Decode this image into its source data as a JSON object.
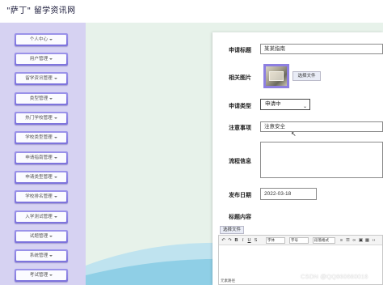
{
  "site": {
    "title": "\"萨丁\" 留学资讯网"
  },
  "sidebar": {
    "items": [
      {
        "label": "个人中心"
      },
      {
        "label": "用户管理"
      },
      {
        "label": "留学资讯管理"
      },
      {
        "label": "类型管理"
      },
      {
        "label": "热门学校管理"
      },
      {
        "label": "学校类型管理"
      },
      {
        "label": "申请指南管理"
      },
      {
        "label": "申请类型管理"
      },
      {
        "label": "学校排名管理"
      },
      {
        "label": "入学测试管理"
      },
      {
        "label": "试题管理"
      },
      {
        "label": "系统管理"
      },
      {
        "label": "考试管理"
      }
    ]
  },
  "form": {
    "title_label": "申请标题",
    "title_value": "某某指南",
    "image_label": "相关图片",
    "choose_file": "选择文件",
    "type_label": "申请类型",
    "type_value": "申请中",
    "notes_label": "注意事项",
    "notes_value": "注意安全",
    "process_label": "流程信息",
    "date_label": "发布日期",
    "date_value": "2022-03-18",
    "content_label": "标题内容",
    "content_choose_file": "选择文件"
  },
  "editor": {
    "font_select": "字体",
    "size_select": "字号",
    "paragraph_select": "段落格式",
    "status": "元素路径"
  },
  "watermark": "CSDN @QQ860660016"
}
